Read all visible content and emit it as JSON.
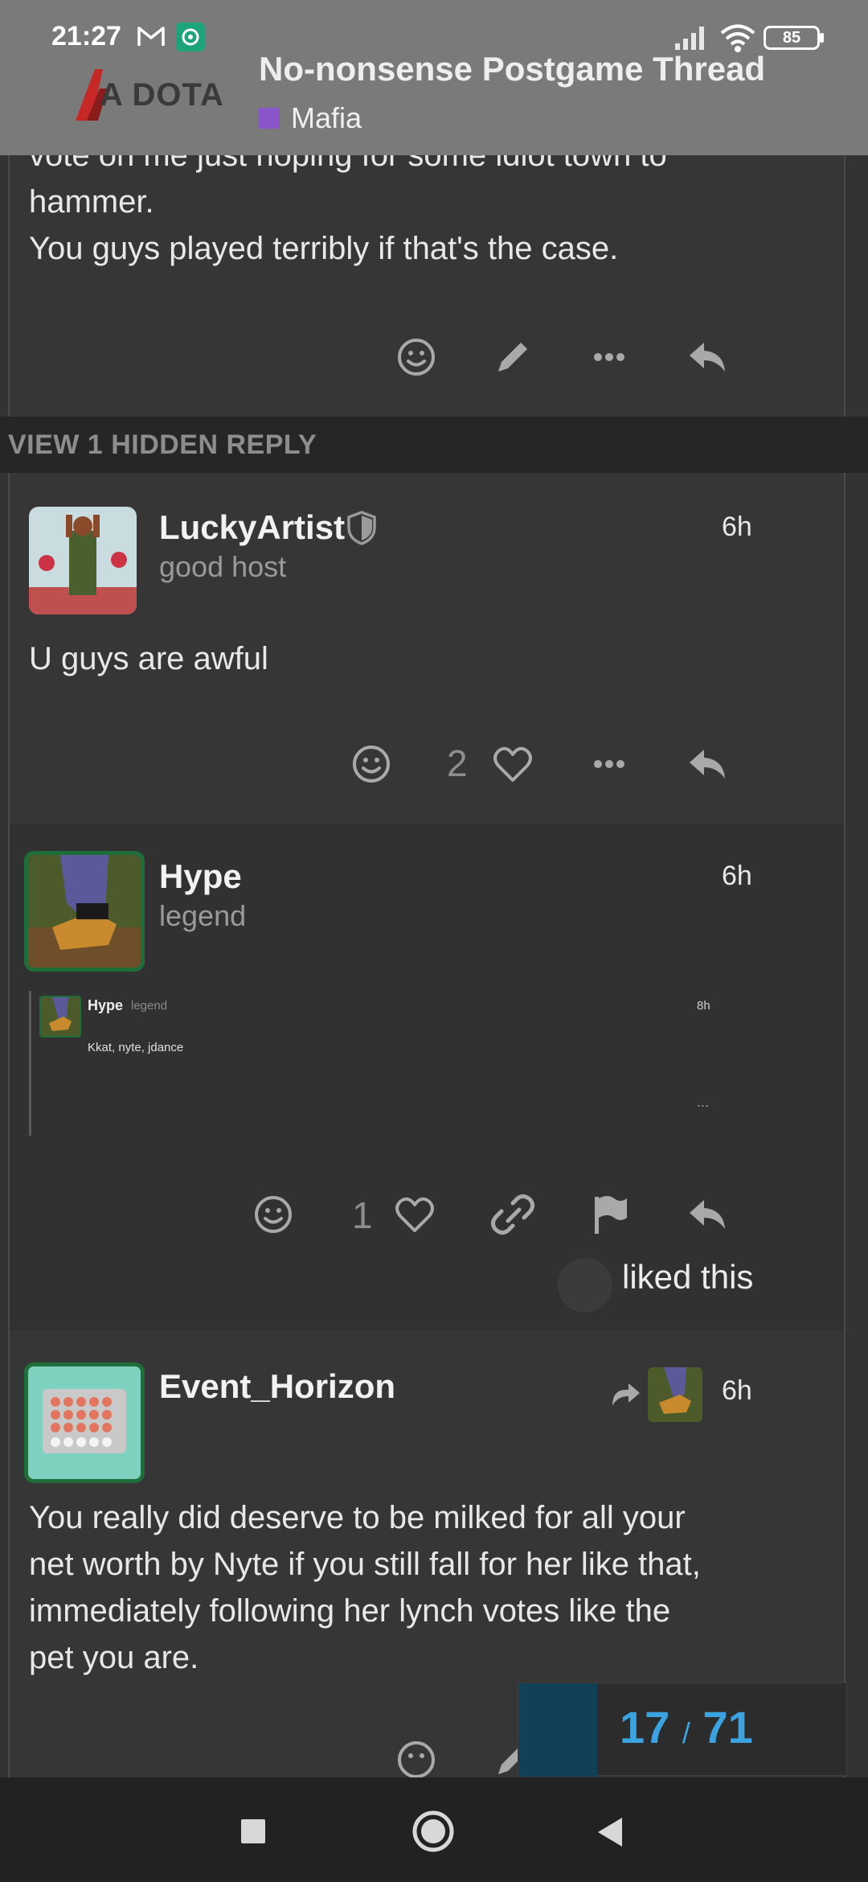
{
  "status_bar": {
    "time": "21:27",
    "battery": "85",
    "icons": [
      "gmail-icon",
      "app-notification-icon",
      "signal-icon",
      "wifi-icon",
      "battery-icon"
    ]
  },
  "header": {
    "logo_text": "A DOTA",
    "topic_title": "No-nonsense Postgame Thread",
    "category": "Mafia",
    "category_color": "#8a55c8"
  },
  "posts": {
    "first": {
      "lines": [
        "vote on me just hoping for some idiot town to",
        "hammer.",
        "You guys played terribly if that's the case."
      ]
    },
    "hidden_reply_label": "VIEW 1 HIDDEN REPLY",
    "lucky": {
      "username": "LuckyArtist",
      "title": "good host",
      "time": "6h",
      "body": "U guys are awful",
      "likes": "2"
    },
    "hype": {
      "username": "Hype",
      "title": "legend",
      "time": "6h",
      "likes": "1",
      "liked_this": "liked this",
      "quote": {
        "username": "Hype",
        "title": "legend",
        "time": "8h",
        "body": "Kkat, nyte, jdance",
        "more": "..."
      }
    },
    "event": {
      "username": "Event_Horizon",
      "time": "6h",
      "lines": [
        "You really did deserve to be milked for all your",
        "net worth by Nyte if you still fall for her like that,",
        "immediately following her lynch votes like the",
        "pet you are."
      ]
    }
  },
  "progress": {
    "current": "17",
    "separator": "/",
    "total": "71",
    "fraction": 0.239
  },
  "colors": {
    "background": "#333333",
    "header": "#7a7a7a",
    "accent": "#3aa3e0",
    "avatar_ring": "#1f6e3a"
  }
}
